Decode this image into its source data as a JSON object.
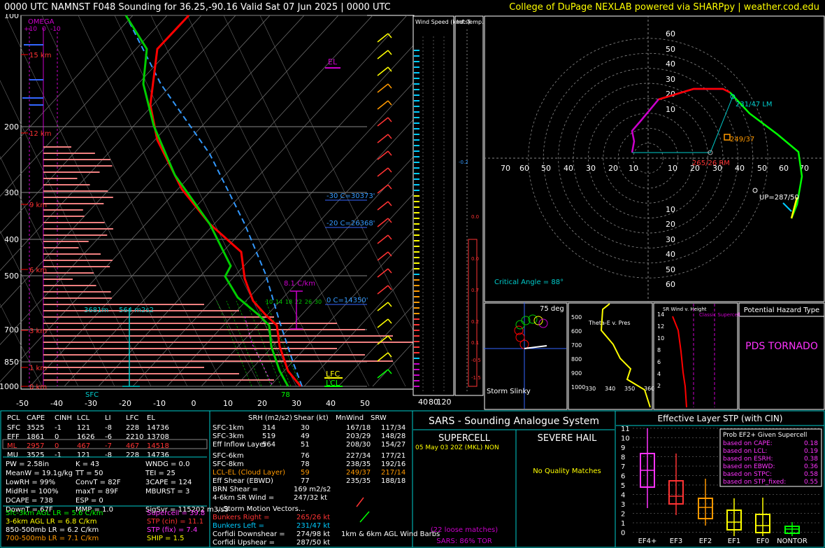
{
  "header": {
    "title": "0000 UTC NAMNST F048 Sounding for 36.25,-90.16 Valid  Sat 07 Jun 2025 | 0000 UTC",
    "credit": "College of DuPage NEXLAB powered via SHARPpy | weather.cod.edu"
  },
  "skewt": {
    "omega_label": "OMEGA",
    "omega_scale": [
      "+10",
      "0",
      "-10"
    ],
    "pressure_ticks": [
      "100",
      "200",
      "300",
      "400",
      "500",
      "700",
      "850",
      "1000"
    ],
    "temp_ticks": [
      "-50",
      "-40",
      "-30",
      "-20",
      "-10",
      "0",
      "10",
      "20",
      "30",
      "40",
      "50"
    ],
    "height_labels": [
      "15 km",
      "12 km",
      "9 km",
      "6 km",
      "3 km",
      "1 km",
      "0 km"
    ],
    "el_label": "EL",
    "lfc_label": "LFC",
    "lcl_label": "LCL",
    "sfc_label": "SFC",
    "sfc_temp": "78",
    "lapse_label": "8.1 C/km",
    "iso_labels": [
      "-30 C=30373'",
      "-20 C=26368'",
      "0 C=14350'"
    ],
    "wetbulb_labels": [
      "10",
      "14",
      "18",
      "22",
      "26",
      "30"
    ],
    "eff_inflow_label": "3681m",
    "eff_inflow_srh": "564 m2s2",
    "colors": {
      "temp": "#ff0000",
      "dewp": "#00cc00",
      "parcel": "#3399ff",
      "isotherm": "#00aaff"
    }
  },
  "side_panels": {
    "wind_speed_title": "Wind Speed (knots)",
    "inf_temp_title": "Inf. Temp. Adv. (C/hr)",
    "wind_axis": [
      "40",
      "80",
      "120"
    ],
    "inf_values": [
      "-0.2",
      "0.0",
      "0.0",
      "0.7",
      "0.2",
      "0.1",
      "-0.5",
      "-1.5"
    ]
  },
  "hodograph": {
    "rings": [
      "10",
      "20",
      "30",
      "40",
      "50",
      "60",
      "70"
    ],
    "y_ticks": [
      "60",
      "50",
      "40",
      "30",
      "20",
      "10",
      "10",
      "20",
      "30",
      "40",
      "50",
      "60"
    ],
    "x_ticks": [
      "70",
      "60",
      "50",
      "40",
      "30",
      "20",
      "10",
      "10",
      "20",
      "30",
      "40",
      "50",
      "60",
      "70"
    ],
    "lm_label": "231/47 LM",
    "mean_label": "249/37",
    "rm_label": "265/26 RM",
    "up_label": "UP=287/50",
    "crit_angle": "Critical Angle = 88°"
  },
  "small_panels": {
    "storm_slinky": "Storm Slinky",
    "slinky_deg": "75 deg",
    "theta_title": "Theta-E v. Pres",
    "theta_y": [
      "500",
      "600",
      "700",
      "800",
      "900",
      "1000"
    ],
    "theta_x": [
      "330",
      "340",
      "350",
      "360"
    ],
    "srwind_title": "SR Wind v. Height",
    "srwind_y": [
      "14",
      "12",
      "10",
      "8",
      "6",
      "4",
      "2"
    ],
    "classic_label": "Classic Supercell",
    "hazard_title": "Potential Hazard Type",
    "hazard_value": "PDS TORNADO"
  },
  "parcels": {
    "headers": [
      "PCL",
      "CAPE",
      "CINH",
      "LCL",
      "LI",
      "LFC",
      "EL"
    ],
    "rows": [
      [
        "SFC",
        "3525",
        "-1",
        "121",
        "-8",
        "228",
        "14736"
      ],
      [
        "EFF",
        "1861",
        "0",
        "1626",
        "-6",
        "2210",
        "13708"
      ],
      [
        "ML",
        "2957",
        "0",
        "467",
        "-7",
        "467",
        "14518"
      ],
      [
        "MU",
        "3525",
        "-1",
        "121",
        "-8",
        "228",
        "14736"
      ]
    ]
  },
  "indices": {
    "col1": [
      "PW = 2.58in",
      "MeanW = 19.1g/kg",
      "LowRH = 99%",
      "MidRH = 100%",
      "DCAPE = 738",
      "DownT = 67F"
    ],
    "col2": [
      "K = 43",
      "TT = 50",
      "ConvT = 82F",
      "maxT = 89F",
      "ESP = 0",
      "MMP = 1.0"
    ],
    "col3": [
      "WNDG = 0.0",
      "TEI = 25",
      "3CAPE = 124",
      "MBURST = 3",
      "",
      "SigSvr = 115202 m3/s3"
    ]
  },
  "lapse": {
    "rows": [
      "Sfc-3km AGL LR = 5.6 C/km",
      "3-6km AGL LR = 6.8 C/km",
      "850-500mb LR = 6.2 C/km",
      "700-500mb LR = 7.1 C/km"
    ],
    "params": [
      "Supercell = 39.8",
      "STP (cin) = 11.1",
      "STP (fix) = 7.4",
      "SHIP = 1.5"
    ]
  },
  "kinematics": {
    "headers": [
      "SRH (m2/s2)",
      "Shear (kt)",
      "MnWind",
      "SRW"
    ],
    "rows": [
      [
        "SFC-1km",
        "314",
        "30",
        "167/18",
        "117/34"
      ],
      [
        "SFC-3km",
        "519",
        "49",
        "203/29",
        "148/28"
      ],
      [
        "Eff Inflow Layer",
        "564",
        "51",
        "208/30",
        "154/27"
      ],
      [
        "SFC-6km",
        "76",
        "227/34",
        "177/21"
      ],
      [
        "SFC-8km",
        "78",
        "238/35",
        "192/16"
      ],
      [
        "LCL-EL (Cloud Layer)",
        "59",
        "249/37",
        "217/14"
      ],
      [
        "Eff Shear (EBWD)",
        "77",
        "235/35",
        "188/18"
      ]
    ],
    "brn_shear": "BRN Shear =",
    "brn_val": "169 m2/s2",
    "sr46": "4-6km SR Wind =",
    "sr46_val": "247/32 kt",
    "motion_title": "...Storm Motion Vectors...",
    "motion": [
      [
        "Bunkers Right =",
        "265/26 kt"
      ],
      [
        "Bunkers Left =",
        "231/47 kt"
      ],
      [
        "Corfidi Downshear =",
        "274/98 kt"
      ],
      [
        "Corfidi Upshear =",
        "287/50 kt"
      ]
    ],
    "barb_label": "1km & 6km AGL Wind Barbs"
  },
  "sars": {
    "title": "SARS - Sounding Analogue System",
    "supercell": "SUPERCELL",
    "hail": "SEVERE HAIL",
    "match": "05 May 03 20Z (MKL)  NON",
    "no_match": "No Quality Matches",
    "loose": "(22 loose matches)",
    "tor": "SARS: 86% TOR"
  },
  "stp": {
    "title": "Effective Layer STP (with CIN)",
    "y_ticks": [
      "11",
      "10",
      "9",
      "8",
      "7",
      "6",
      "5",
      "4",
      "3",
      "2",
      "1",
      "0"
    ],
    "x_labels": [
      "EF4+",
      "EF3",
      "EF2",
      "EF1",
      "EF0",
      "NONTOR"
    ],
    "legend_title": "Prob EF2+ Given Supercell",
    "legend": [
      [
        "based on CAPE:",
        "0.18"
      ],
      [
        "based on LCL:",
        "0.19"
      ],
      [
        "based on ESRH:",
        "0.38"
      ],
      [
        "based on EBWD:",
        "0.36"
      ],
      [
        "based on STPC:",
        "0.58"
      ],
      [
        "based on STP_fixed:",
        "0.55"
      ]
    ]
  }
}
